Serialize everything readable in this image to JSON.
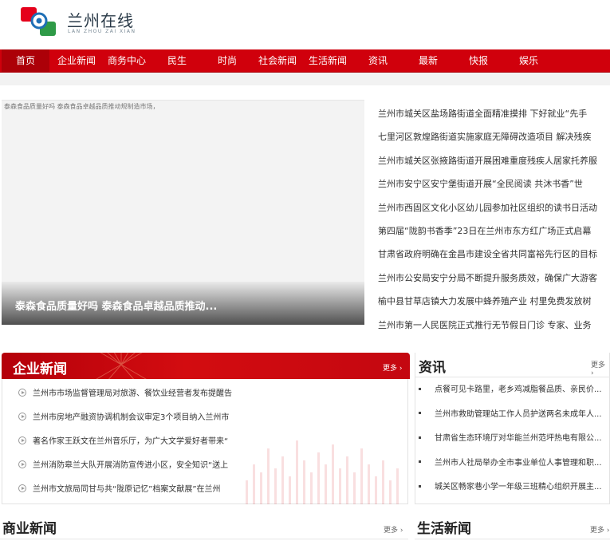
{
  "brand": {
    "title": "兰州在线",
    "subtitle": "LAN ZHOU ZAI XIAN",
    "colors": {
      "red": "#e5001b",
      "green": "#2e9a47",
      "blue": "#1f6fb6"
    }
  },
  "nav": {
    "items": [
      {
        "label": "首页",
        "active": true
      },
      {
        "label": "企业新闻"
      },
      {
        "label": "商务中心"
      },
      {
        "label": "民生"
      },
      {
        "label": "时尚"
      },
      {
        "label": "社会新闻"
      },
      {
        "label": "生活新闻"
      },
      {
        "label": "资讯"
      },
      {
        "label": "最新"
      },
      {
        "label": "快报"
      },
      {
        "label": "娱乐"
      }
    ]
  },
  "hero": {
    "image_alt": "泰森食品质量好吗 泰森食品卓越品质推动规制造市场，",
    "caption": "泰森食品质量好吗 泰森食品卓越品质推动..."
  },
  "headlines": [
    "兰州市城关区盐场路街道全面精准摸排 下好就业“先手",
    "七里河区敦煌路街道实施家庭无障碍改造项目 解决残疾",
    "兰州市城关区张掖路街道开展困难重度残疾人居家托养服",
    "兰州市安宁区安宁堡街道开展“全民阅读 共沐书香”世",
    "兰州市西固区文化小区幼儿园参加社区组织的读书日活动",
    "第四届“陇韵书香季”23日在兰州市东方红广场正式启幕",
    "甘肃省政府明确在金昌市建设全省共同富裕先行区的目标",
    "兰州市公安局安宁分局不断提升服务质效，确保广大游客",
    "榆中县甘草店镇大力发展中蜂养殖产业 村里免费发放树",
    "兰州市第一人民医院正式推行无节假日门诊 专家、业务"
  ],
  "enterprise_news": {
    "title": "企业新闻",
    "more": "更多 ›",
    "items": [
      "兰州市市场监督管理局对旅游、餐饮业经营者发布提醒告",
      "兰州市房地产融资协调机制会议审定3个项目纳入兰州市",
      "著名作家王跃文在兰州音乐厅，为广大文学爱好者带来“",
      "兰州消防皋兰大队开展消防宣传进小区，安全知识“送上",
      "兰州市文旅局同甘与共“陇原记忆”档案文献展”在兰州"
    ]
  },
  "info": {
    "title": "资讯",
    "more": "更多 ›",
    "items": [
      "点餐可见卡路里，老乡鸡减脂餐品质、亲民价...",
      "兰州市救助管理站工作人员护送两名未成年人...",
      "甘肃省生态环境厅对华能兰州范坪热电有限公...",
      "兰州市人社局举办全市事业单位人事管理和职...",
      "城关区畅家巷小学一年级三班精心组织开展主..."
    ]
  },
  "business_news": {
    "title": "商业新闻",
    "more": "更多 ›"
  },
  "life_news": {
    "title": "生活新闻",
    "more": "更多 ›"
  }
}
